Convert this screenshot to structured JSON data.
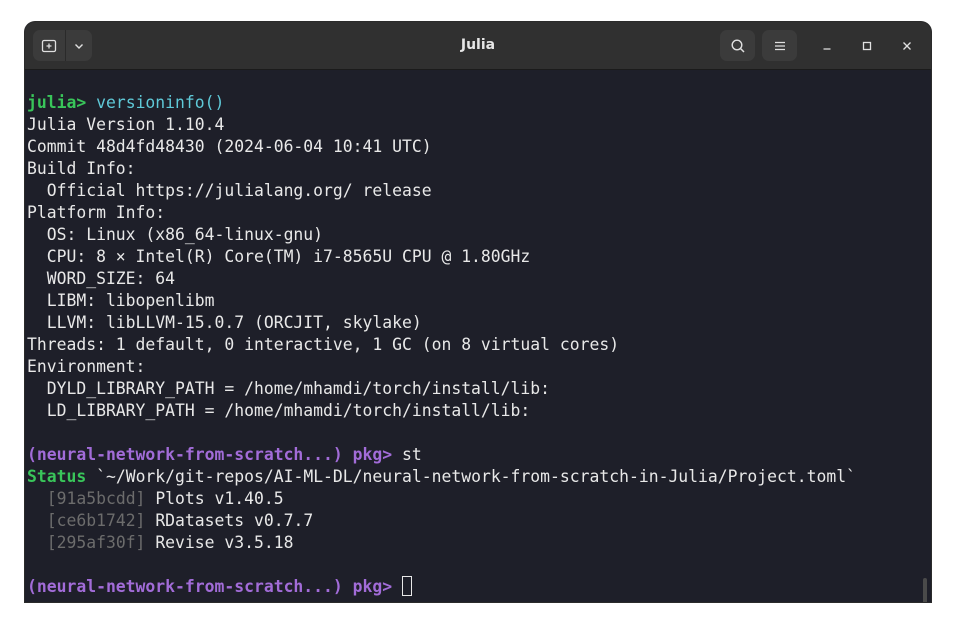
{
  "window": {
    "title": "Julia"
  },
  "icons": {
    "new_tab": "new-tab-icon",
    "dropdown": "chevron-down-icon",
    "search": "search-icon",
    "menu": "hamburger-menu-icon",
    "minimize": "minimize-icon",
    "maximize": "maximize-icon",
    "close": "close-icon"
  },
  "colors": {
    "terminal_bg": "#1e1f29",
    "titlebar_bg": "#303030",
    "julia_prompt": "#39c55a",
    "pkg_prompt": "#a26cd8",
    "command_cyan": "#5fc9d8",
    "uuid_gray": "#6c6c6c",
    "text": "#e8e8e8"
  },
  "terminal": {
    "julia_prompt": "julia>",
    "versioninfo_cmd": "versioninfo()",
    "output": [
      "Julia Version 1.10.4",
      "Commit 48d4fd48430 (2024-06-04 10:41 UTC)",
      "Build Info:",
      "  Official https://julialang.org/ release",
      "Platform Info:",
      "  OS: Linux (x86_64-linux-gnu)",
      "  CPU: 8 × Intel(R) Core(TM) i7-8565U CPU @ 1.80GHz",
      "  WORD_SIZE: 64",
      "  LIBM: libopenlibm",
      "  LLVM: libLLVM-15.0.7 (ORCJIT, skylake)",
      "Threads: 1 default, 0 interactive, 1 GC (on 8 virtual cores)",
      "Environment:",
      "  DYLD_LIBRARY_PATH = /home/mhamdi/torch/install/lib:",
      "  LD_LIBRARY_PATH = /home/mhamdi/torch/install/lib:"
    ],
    "pkg_prompt": "(neural-network-from-scratch...) pkg>",
    "pkg_cmd": "st",
    "status_label": "Status",
    "status_path": "`~/Work/git-repos/AI-ML-DL/neural-network-from-scratch-in-Julia/Project.toml`",
    "packages": [
      {
        "uuid": "[91a5bcdd]",
        "name": "Plots v1.40.5"
      },
      {
        "uuid": "[ce6b1742]",
        "name": "RDatasets v0.7.7"
      },
      {
        "uuid": "[295af30f]",
        "name": "Revise v3.5.18"
      }
    ],
    "final_prompt": "(neural-network-from-scratch...) pkg>"
  }
}
